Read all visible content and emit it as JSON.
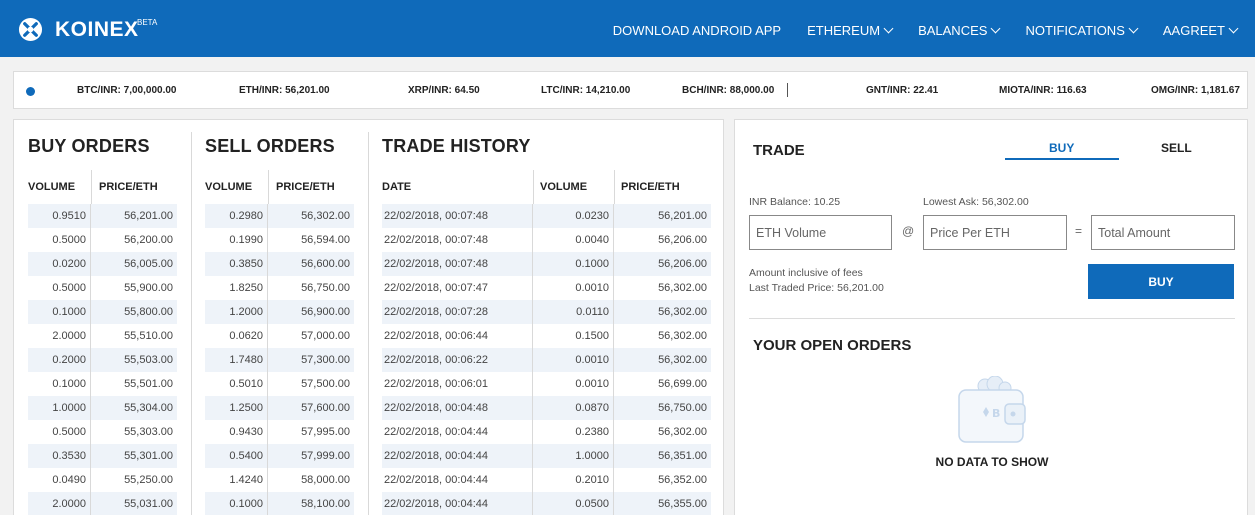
{
  "brand": {
    "name": "KOINEX",
    "badge": "BETA"
  },
  "nav": [
    {
      "label": "DOWNLOAD ANDROID APP",
      "dropdown": false
    },
    {
      "label": "ETHEREUM",
      "dropdown": true
    },
    {
      "label": "BALANCES",
      "dropdown": true
    },
    {
      "label": "NOTIFICATIONS",
      "dropdown": true
    },
    {
      "label": "AAGREET",
      "dropdown": true
    }
  ],
  "ticker": [
    "BTC/INR: 7,00,000.00",
    "ETH/INR: 56,201.00",
    "XRP/INR: 64.50",
    "LTC/INR: 14,210.00",
    "BCH/INR: 88,000.00",
    "GNT/INR: 22.41",
    "MIOTA/INR: 116.63",
    "OMG/INR: 1,181.67"
  ],
  "buy_orders": {
    "title": "BUY ORDERS",
    "headers": [
      "VOLUME",
      "PRICE/ETH"
    ],
    "rows": [
      [
        "0.9510",
        "56,201.00"
      ],
      [
        "0.5000",
        "56,200.00"
      ],
      [
        "0.0200",
        "56,005.00"
      ],
      [
        "0.5000",
        "55,900.00"
      ],
      [
        "0.1000",
        "55,800.00"
      ],
      [
        "2.0000",
        "55,510.00"
      ],
      [
        "0.2000",
        "55,503.00"
      ],
      [
        "0.1000",
        "55,501.00"
      ],
      [
        "1.0000",
        "55,304.00"
      ],
      [
        "0.5000",
        "55,303.00"
      ],
      [
        "0.3530",
        "55,301.00"
      ],
      [
        "0.0490",
        "55,250.00"
      ],
      [
        "2.0000",
        "55,031.00"
      ]
    ]
  },
  "sell_orders": {
    "title": "SELL ORDERS",
    "headers": [
      "VOLUME",
      "PRICE/ETH"
    ],
    "rows": [
      [
        "0.2980",
        "56,302.00"
      ],
      [
        "0.1990",
        "56,594.00"
      ],
      [
        "0.3850",
        "56,600.00"
      ],
      [
        "1.8250",
        "56,750.00"
      ],
      [
        "1.2000",
        "56,900.00"
      ],
      [
        "0.0620",
        "57,000.00"
      ],
      [
        "1.7480",
        "57,300.00"
      ],
      [
        "0.5010",
        "57,500.00"
      ],
      [
        "1.2500",
        "57,600.00"
      ],
      [
        "0.9430",
        "57,995.00"
      ],
      [
        "0.5400",
        "57,999.00"
      ],
      [
        "1.4240",
        "58,000.00"
      ],
      [
        "0.1000",
        "58,100.00"
      ]
    ]
  },
  "trade_history": {
    "title": "TRADE HISTORY",
    "headers": [
      "DATE",
      "VOLUME",
      "PRICE/ETH"
    ],
    "rows": [
      [
        "22/02/2018, 00:07:48",
        "0.0230",
        "56,201.00"
      ],
      [
        "22/02/2018, 00:07:48",
        "0.0040",
        "56,206.00"
      ],
      [
        "22/02/2018, 00:07:48",
        "0.1000",
        "56,206.00"
      ],
      [
        "22/02/2018, 00:07:47",
        "0.0010",
        "56,302.00"
      ],
      [
        "22/02/2018, 00:07:28",
        "0.0110",
        "56,302.00"
      ],
      [
        "22/02/2018, 00:06:44",
        "0.1500",
        "56,302.00"
      ],
      [
        "22/02/2018, 00:06:22",
        "0.0010",
        "56,302.00"
      ],
      [
        "22/02/2018, 00:06:01",
        "0.0010",
        "56,699.00"
      ],
      [
        "22/02/2018, 00:04:48",
        "0.0870",
        "56,750.00"
      ],
      [
        "22/02/2018, 00:04:44",
        "0.2380",
        "56,302.00"
      ],
      [
        "22/02/2018, 00:04:44",
        "1.0000",
        "56,351.00"
      ],
      [
        "22/02/2018, 00:04:44",
        "0.2010",
        "56,352.00"
      ],
      [
        "22/02/2018, 00:04:44",
        "0.0500",
        "56,355.00"
      ]
    ]
  },
  "trade": {
    "title": "TRADE",
    "tabs": {
      "buy": "BUY",
      "sell": "SELL",
      "active": "BUY"
    },
    "inr_balance": "INR Balance: 10.25",
    "lowest_ask": "Lowest Ask: 56,302.00",
    "volume_placeholder": "ETH Volume",
    "at_symbol": "@",
    "price_placeholder": "Price Per ETH",
    "equals_symbol": "=",
    "total_placeholder": "Total Amount",
    "fees_note": "Amount inclusive of fees",
    "last_traded": "Last Traded Price: 56,201.00",
    "buy_button": "BUY"
  },
  "open_orders": {
    "title": "YOUR OPEN ORDERS",
    "empty_text": "NO DATA TO SHOW"
  },
  "colors": {
    "brand_blue": "#0f6aba",
    "row_highlight": "#eef3f9"
  }
}
